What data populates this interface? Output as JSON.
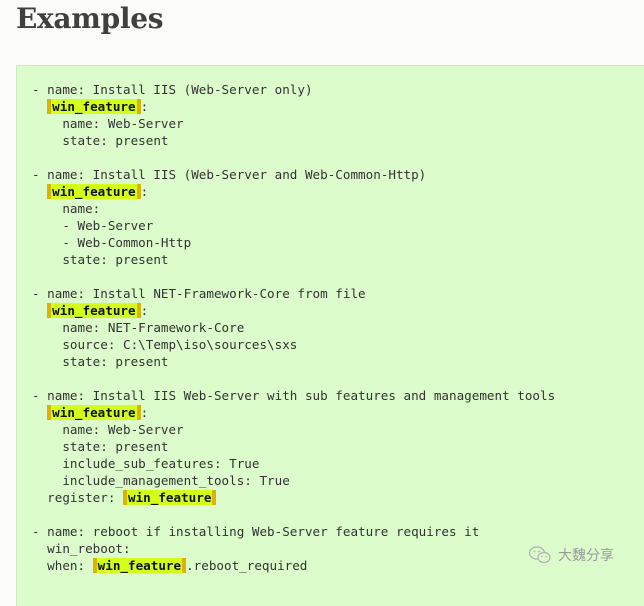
{
  "heading": "Examples",
  "highlight_color": "#d4ff1a",
  "code_background": "#dcfccc",
  "code": {
    "lines": [
      [
        {
          "t": "- name: Install IIS (Web-Server only)"
        }
      ],
      [
        {
          "t": "  "
        },
        {
          "t": "win_feature",
          "hl": true
        },
        {
          "t": ":"
        }
      ],
      [
        {
          "t": "    name: Web-Server"
        }
      ],
      [
        {
          "t": "    state: present"
        }
      ],
      [
        {
          "t": ""
        }
      ],
      [
        {
          "t": "- name: Install IIS (Web-Server and Web-Common-Http)"
        }
      ],
      [
        {
          "t": "  "
        },
        {
          "t": "win_feature",
          "hl": true
        },
        {
          "t": ":"
        }
      ],
      [
        {
          "t": "    name:"
        }
      ],
      [
        {
          "t": "    - Web-Server"
        }
      ],
      [
        {
          "t": "    - Web-Common-Http"
        }
      ],
      [
        {
          "t": "    state: present"
        }
      ],
      [
        {
          "t": ""
        }
      ],
      [
        {
          "t": "- name: Install NET-Framework-Core from file"
        }
      ],
      [
        {
          "t": "  "
        },
        {
          "t": "win_feature",
          "hl": true
        },
        {
          "t": ":"
        }
      ],
      [
        {
          "t": "    name: NET-Framework-Core"
        }
      ],
      [
        {
          "t": "    source: C:\\Temp\\iso\\sources\\sxs"
        }
      ],
      [
        {
          "t": "    state: present"
        }
      ],
      [
        {
          "t": ""
        }
      ],
      [
        {
          "t": "- name: Install IIS Web-Server with sub features and management tools"
        }
      ],
      [
        {
          "t": "  "
        },
        {
          "t": "win_feature",
          "hl": true
        },
        {
          "t": ":"
        }
      ],
      [
        {
          "t": "    name: Web-Server"
        }
      ],
      [
        {
          "t": "    state: present"
        }
      ],
      [
        {
          "t": "    include_sub_features: True"
        }
      ],
      [
        {
          "t": "    include_management_tools: True"
        }
      ],
      [
        {
          "t": "  register: "
        },
        {
          "t": "win_feature",
          "hl": true
        }
      ],
      [
        {
          "t": ""
        }
      ],
      [
        {
          "t": "- name: reboot if installing Web-Server feature requires it"
        }
      ],
      [
        {
          "t": "  win_reboot:"
        }
      ],
      [
        {
          "t": "  when: "
        },
        {
          "t": "win_feature",
          "hl": true
        },
        {
          "t": ".reboot_required"
        }
      ]
    ]
  },
  "watermark": {
    "icon": "wechat-icon",
    "text": "大魏分享"
  }
}
